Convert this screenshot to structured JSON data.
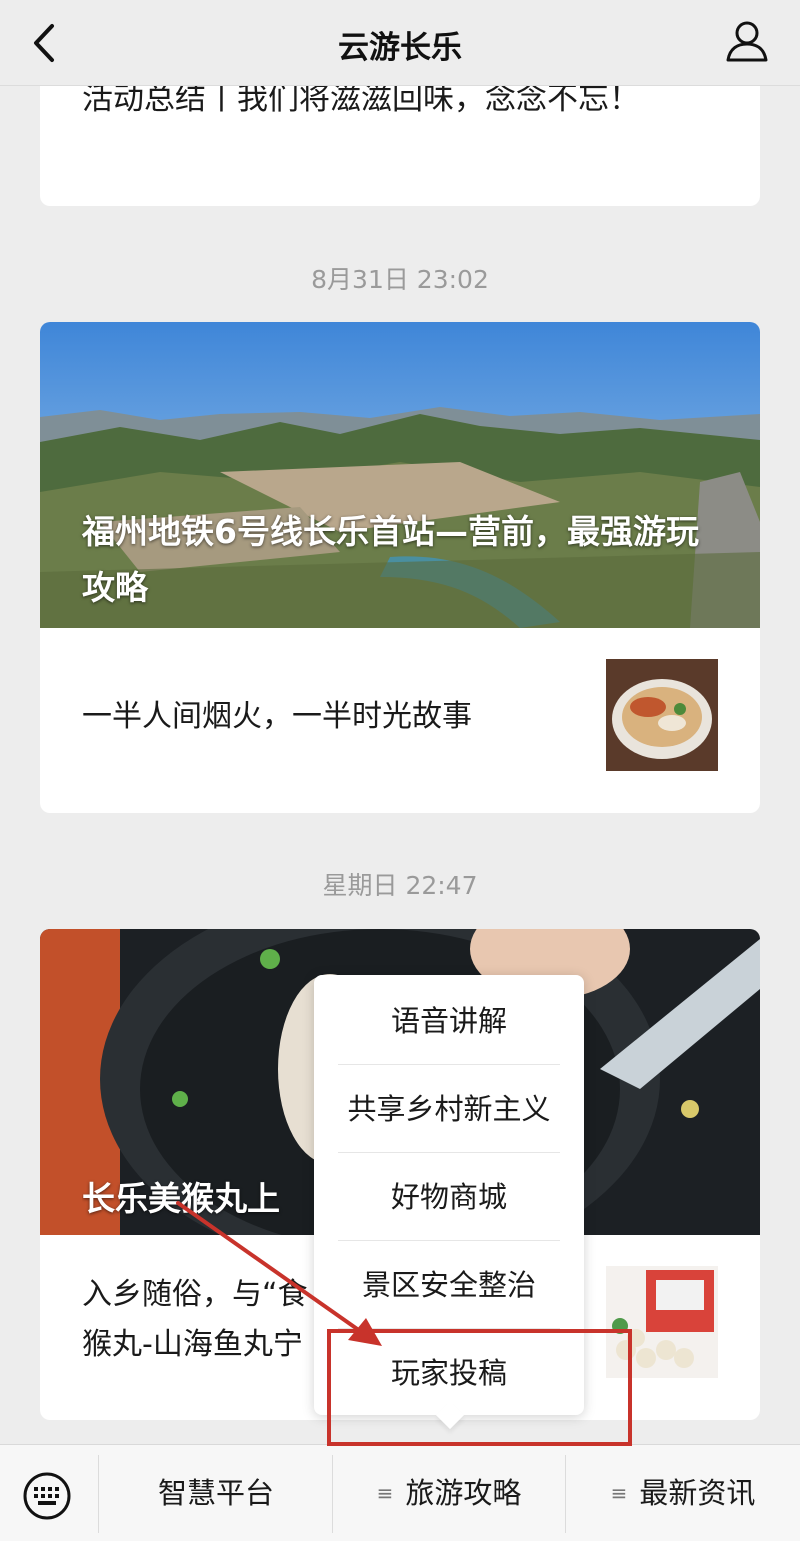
{
  "nav": {
    "title": "云游长乐",
    "back_icon": "chevron-left-icon",
    "user_icon": "user-icon"
  },
  "messages": [
    {
      "text": "活动总结丨我们将滋滋回味，念念不忘！"
    },
    {
      "timestamp": "8月31日 23:02",
      "cover_title": "福州地铁6号线长乐首站—营前，最强游玩攻略",
      "sub_text": "一半人间烟火，一半时光故事"
    },
    {
      "timestamp": "星期日 22:47",
      "cover_title": "长乐美猴丸上",
      "sub_text": "入乡随俗，与“食猴丸-山海鱼丸宁"
    }
  ],
  "popup_menu": {
    "items": [
      "语音讲解",
      "共享乡村新主义",
      "好物商城",
      "景区安全整治",
      "玩家投稿"
    ],
    "highlighted": "玩家投稿"
  },
  "bottom_bar": {
    "keyboard_icon": "keyboard-icon",
    "items": [
      "智慧平台",
      "旅游攻略",
      "最新资讯"
    ]
  },
  "colors": {
    "background": "#ededed",
    "annotation": "#c8332b"
  }
}
